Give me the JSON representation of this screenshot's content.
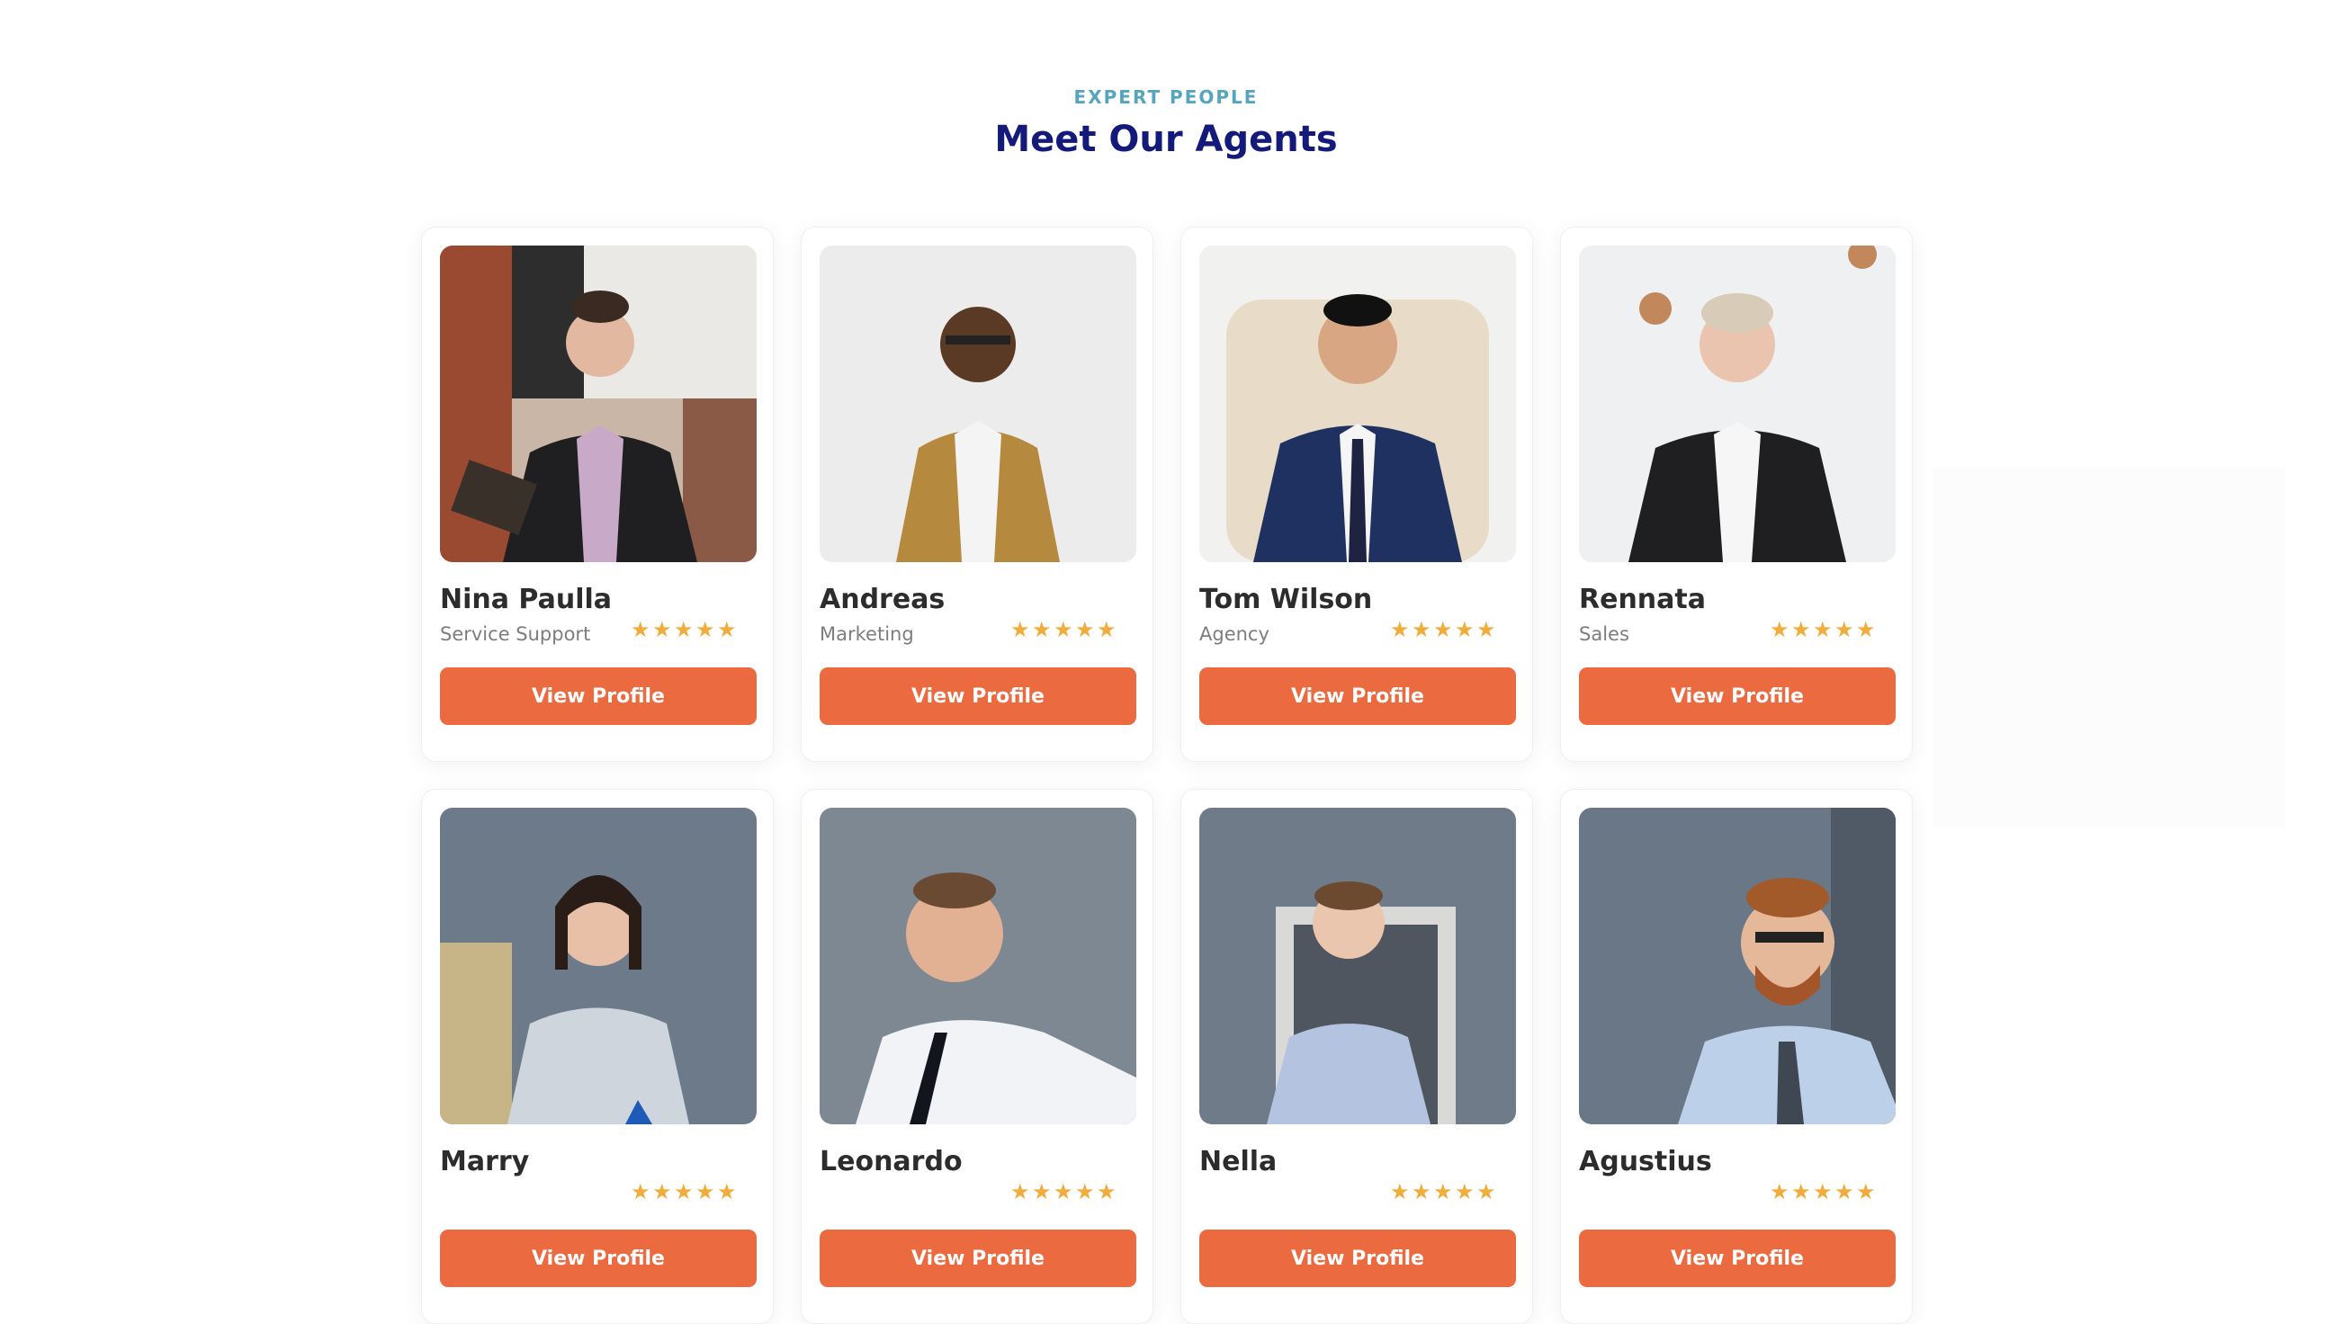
{
  "section": {
    "eyebrow": "EXPERT PEOPLE",
    "title": "Meet Our Agents"
  },
  "agents": [
    {
      "name": "Nina Paulla",
      "role": "Service Support",
      "rating": 5,
      "button": "View Profile"
    },
    {
      "name": "Andreas",
      "role": "Marketing",
      "rating": 5,
      "button": "View Profile"
    },
    {
      "name": "Tom Wilson",
      "role": "Agency",
      "rating": 5,
      "button": "View Profile"
    },
    {
      "name": "Rennata",
      "role": "Sales",
      "rating": 5,
      "button": "View Profile"
    },
    {
      "name": "Marry",
      "role": "",
      "rating": 5,
      "button": "View Profile"
    },
    {
      "name": "Leonardo",
      "role": "",
      "rating": 5,
      "button": "View Profile"
    },
    {
      "name": "Nella",
      "role": "",
      "rating": 5,
      "button": "View Profile"
    },
    {
      "name": "Agustius",
      "role": "",
      "rating": 5,
      "button": "View Profile"
    }
  ],
  "colors": {
    "accent": "#ec6a3f",
    "heading": "#141a7a",
    "eyebrow": "#54a5bd",
    "star": "#f1ac3c"
  }
}
